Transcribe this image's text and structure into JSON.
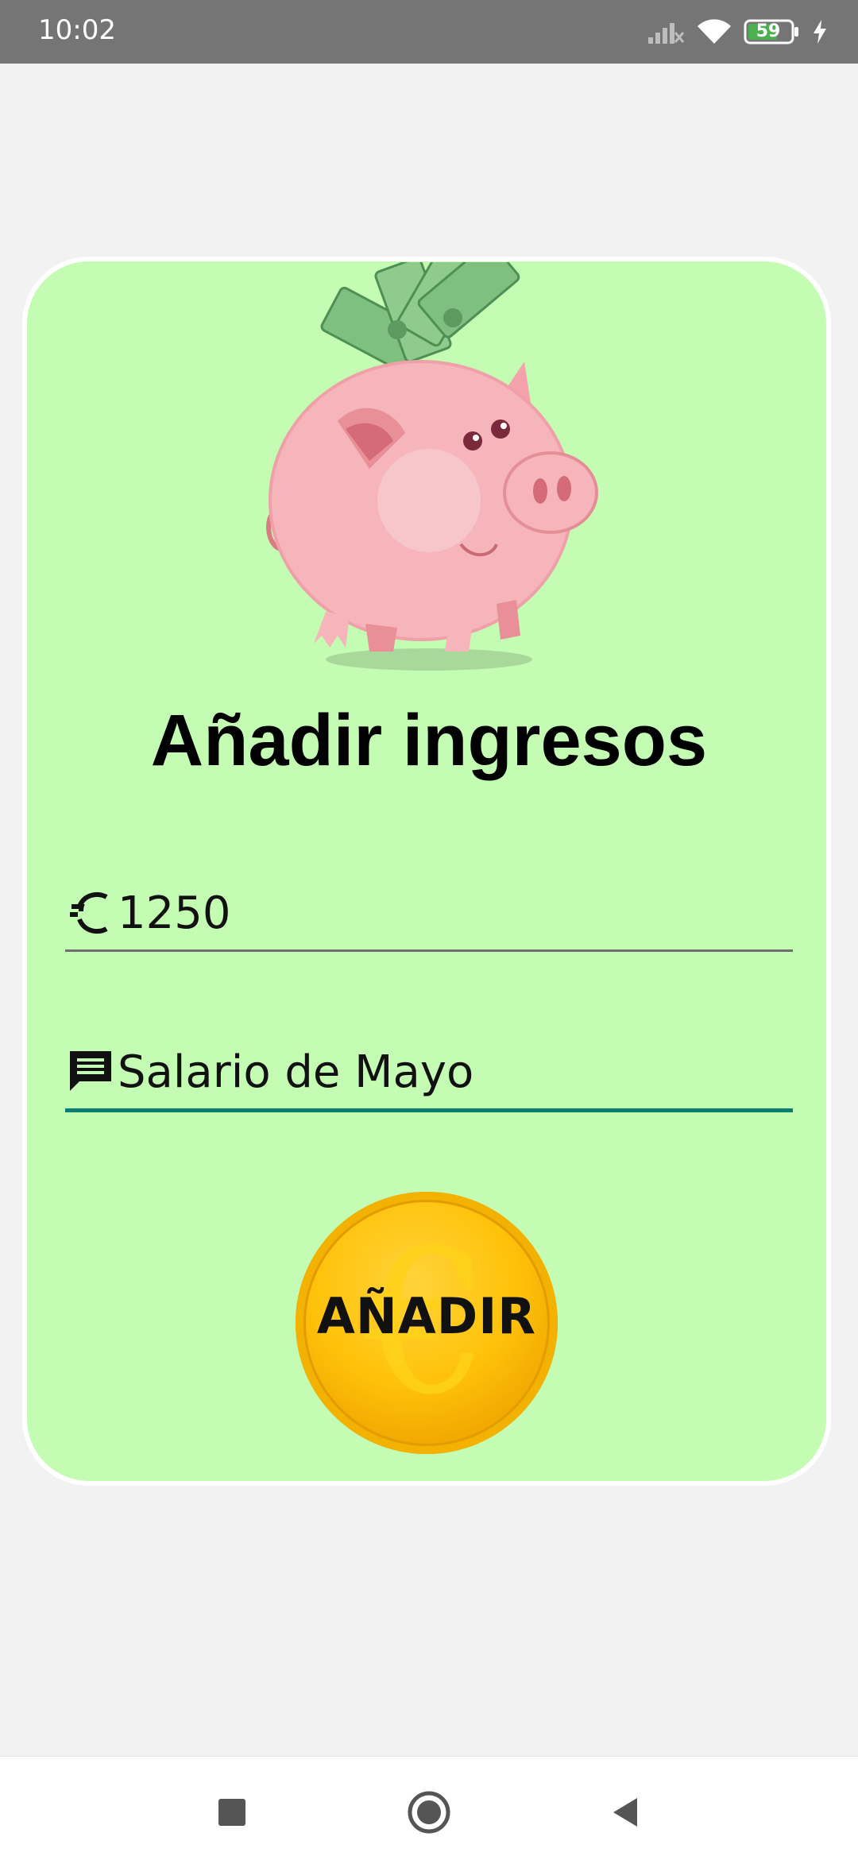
{
  "status_bar": {
    "time": "10:02",
    "battery_level": "59",
    "icons": [
      "signal-icon",
      "wifi-icon",
      "battery-icon",
      "charging-icon"
    ]
  },
  "card": {
    "title": "Añadir ingresos",
    "background_color": "#c4fcb3"
  },
  "form": {
    "amount": {
      "icon": "euro-icon",
      "value": "1250"
    },
    "description": {
      "icon": "message-icon",
      "value": "Salario de Mayo"
    },
    "submit_label": "AÑADIR"
  },
  "nav_bar": {
    "buttons": [
      "recents-button",
      "home-button",
      "back-button"
    ]
  },
  "colors": {
    "accent_underline": "#0a7f70",
    "coin_gold": "#ffc20a"
  }
}
